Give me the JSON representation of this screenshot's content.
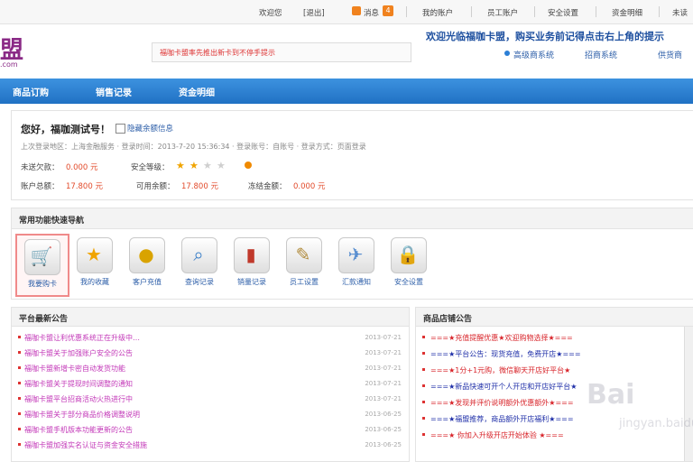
{
  "topbar": {
    "items": [
      "欢迎您",
      "[退出]",
      "消息",
      "我的账户",
      "员工账户",
      "安全设置",
      "资金明细",
      "未读"
    ],
    "message_count": "4"
  },
  "header": {
    "logo_char": "盟",
    "logo_sub": ".com",
    "marquee": "福咖卡盟率先推出新卡到不停手提示",
    "welcome": "欢迎光临福咖卡盟，购买业务前记得点击右上角的提示",
    "links": [
      "高级商系统",
      "招商系统",
      "供货商"
    ]
  },
  "nav": {
    "items": [
      "商品订购",
      "销售记录",
      "资金明细"
    ]
  },
  "account": {
    "greeting": "您好，福咖测试号！",
    "hide_label": "隐藏余额信息",
    "last_login": "上次登录地区：上海金融服务 · 登录时间：2013-7-20 15:36:34 · 登录账号：自账号 · 登录方式：页面登录",
    "frozen_label": "未送欠款：",
    "frozen_value": "0.000 元",
    "level_label": "安全等级：",
    "level_stars": 2,
    "level_total": 4,
    "balance_label": "账户总额：",
    "balance_value": "17.800 元",
    "available_label": "可用余额：",
    "available_value": "17.800 元",
    "locked_label": "冻结金额：",
    "locked_value": "0.000 元"
  },
  "quicknav": {
    "title": "常用功能快速导航",
    "items": [
      {
        "label": "我要购卡",
        "icon": "cart-icon"
      },
      {
        "label": "我的收藏",
        "icon": "star-icon"
      },
      {
        "label": "客户充值",
        "icon": "coins-icon"
      },
      {
        "label": "查询记录",
        "icon": "search-icon"
      },
      {
        "label": "销量记录",
        "icon": "book-icon"
      },
      {
        "label": "员工设置",
        "icon": "notepad-icon"
      },
      {
        "label": "汇款通知",
        "icon": "send-icon"
      },
      {
        "label": "安全设置",
        "icon": "lock-icon"
      }
    ]
  },
  "notices": {
    "title": "平台最新公告",
    "rows": [
      {
        "text": "福咖卡盟让利优惠系统正在升级中…",
        "date": "2013-07-21"
      },
      {
        "text": "福咖卡盟关于加强账户安全的公告",
        "date": "2013-07-21"
      },
      {
        "text": "福咖卡盟新增卡密自动发货功能",
        "date": "2013-07-21"
      },
      {
        "text": "福咖卡盟关于提现时间调整的通知",
        "date": "2013-07-21"
      },
      {
        "text": "福咖卡盟平台招商活动火热进行中",
        "date": "2013-07-21"
      },
      {
        "text": "福咖卡盟关于部分商品价格调整说明",
        "date": "2013-06-25"
      },
      {
        "text": "福咖卡盟手机版本功能更新的公告",
        "date": "2013-06-25"
      },
      {
        "text": "福咖卡盟加强实名认证与资金安全措施",
        "date": "2013-06-25"
      }
    ]
  },
  "product_notices": {
    "title": "商品店铺公告",
    "rows": [
      {
        "text": "===★充值提醒优惠★欢迎购物选择★===",
        "color": "#d8242a"
      },
      {
        "text": "===★平台公告：现货充值，免费开店★===",
        "color": "#1f2fa8"
      },
      {
        "text": "===★1分+1元购，微信聊天开店好平台★",
        "color": "#d8242a"
      },
      {
        "text": "===★新品快速可开个人开店和开店好平台★",
        "color": "#1f2fa8"
      },
      {
        "text": "===★发现并评价说明额外优惠额外★===",
        "color": "#d8242a"
      },
      {
        "text": "===★福盟推荐，商品额外开店福利★===",
        "color": "#1f2fa8"
      },
      {
        "text": "===★ 你加入升级开店开始体验 ★===",
        "color": "#d8242a"
      }
    ]
  },
  "watermark": {
    "main": "Bai",
    "sub": "jingyan.baidu"
  }
}
